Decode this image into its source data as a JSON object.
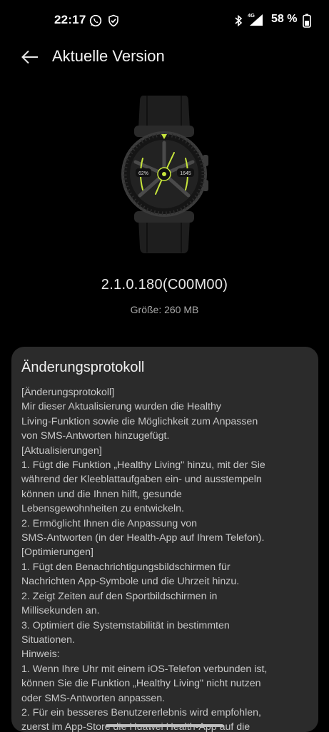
{
  "status_bar": {
    "time": "22:17",
    "network": "4G",
    "battery": "58 %"
  },
  "header": {
    "title": "Aktuelle Version"
  },
  "watch": {
    "left_dial": "62%",
    "right_dial": "1645"
  },
  "update": {
    "version": "2.1.0.180(C00M00)",
    "size": "Größe: 260 MB"
  },
  "changelog": {
    "title": "Änderungsprotokoll",
    "lines": [
      "[Änderungsprotokoll]",
      "Mir dieser Aktualisierung wurden die Healthy",
      "Living-Funktion sowie die Möglichkeit zum Anpassen",
      "von SMS-Antworten hinzugefügt.",
      "[Aktualisierungen]",
      "1. Fügt die Funktion „Healthy Living\" hinzu, mit der Sie",
      "während der Kleeblattaufgaben ein- und ausstempeln",
      "können und die Ihnen hilft, gesunde",
      "Lebensgewohnheiten zu entwickeln.",
      "2. Ermöglicht Ihnen die Anpassung von",
      "SMS-Antworten (in der Health-App auf Ihrem Telefon).",
      "[Optimierungen]",
      "1. Fügt den Benachrichtigungsbildschirmen für",
      "Nachrichten App-Symbole und die Uhrzeit hinzu.",
      "2. Zeigt Zeiten auf den Sportbildschirmen in",
      "Millisekunden an.",
      "3. Optimiert die Systemstabilität in bestimmten",
      "Situationen.",
      "Hinweis:",
      "1. Wenn Ihre Uhr mit einem iOS-Telefon verbunden ist,",
      "können Sie die Funktion „Healthy Living\" nicht nutzen",
      "oder SMS-Antworten anpassen.",
      "2. Für ein besseres Benutzererlebnis wird empfohlen,",
      "zuerst im App-Store die Huawei Health-App auf die"
    ]
  },
  "colors": {
    "background": "#000000",
    "card": "#2b2b2b",
    "accent": "#c8e63c"
  }
}
